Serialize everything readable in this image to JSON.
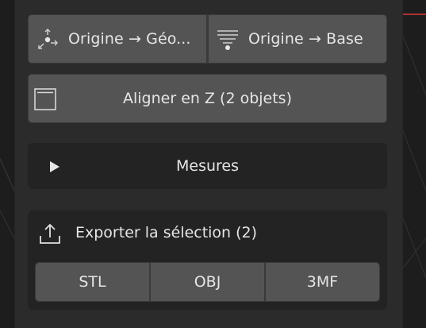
{
  "toolbar": {
    "origin_geometry_label": "Origine → Géo...",
    "origin_base_label": "Origine → Base",
    "align_z_label": "Aligner en Z (2 objets)"
  },
  "measures": {
    "title": "Mesures",
    "expanded": false
  },
  "export": {
    "title": "Exporter la sélection (2)",
    "formats": [
      "STL",
      "OBJ",
      "3MF"
    ]
  },
  "colors": {
    "panel_bg": "#2b2b2b",
    "button_bg": "#545454",
    "section_bg": "#232323",
    "viewport_accent": "#d83a3a"
  }
}
